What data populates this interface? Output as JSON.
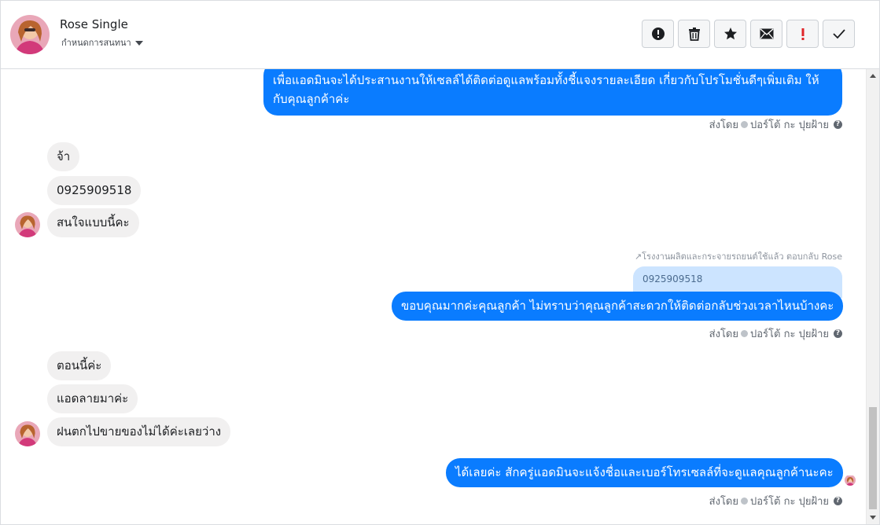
{
  "header": {
    "contact_name": "Rose Single",
    "assign_label": "กำหนดการสนทนา",
    "toolbar": [
      {
        "name": "spam-button",
        "icon": "alert-circle-icon"
      },
      {
        "name": "delete-button",
        "icon": "trash-icon"
      },
      {
        "name": "star-button",
        "icon": "star-icon"
      },
      {
        "name": "mark-unread-button",
        "icon": "envelope-icon"
      },
      {
        "name": "follow-up-button",
        "icon": "exclamation-icon"
      },
      {
        "name": "mark-done-button",
        "icon": "check-icon"
      }
    ]
  },
  "messages": {
    "m1": "เพื่อแอดมินจะได้ประสานงานให้เซลล์ได้ติดต่อดูแลพร้อมทั้งชี้แจงรายละเอียด เกี่ยวกับโปรโมชั่นดีๆเพิ่มเติม ให้กับคุณลูกค้าค่ะ",
    "m1_sent": {
      "prefix": "ส่งโดย",
      "sender": "ปอร์โต้ กะ ปุยฝ้าย"
    },
    "m2": "จ้า",
    "m3": "0925909518",
    "m4": "สนใจแบบนี้คะ",
    "reply_note": "โรงงานผลิตและกระจายรถยนต์ใช้แล้ว ตอบกลับ Rose",
    "quoted_text": "0925909518",
    "m5": "ขอบคุณมากค่ะคุณลูกค้า ไม่ทราบว่าคุณลูกค้าสะดวกให้ติดต่อกลับช่วงเวลาไหนบ้างคะ",
    "m5_sent": {
      "prefix": "ส่งโดย",
      "sender": "ปอร์โต้ กะ ปุยฝ้าย"
    },
    "m6": "ตอนนี้ค่ะ",
    "m7": "แอดลายมาค่ะ",
    "m8": "ฝนตกไปขายของไม่ได้ค่ะเลยว่าง",
    "m9": "ได้เลยค่ะ สักครู่แอดมินจะแจ้งชื่อและเบอร์โทรเซลล์ที่จะดูแลคุณลูกค้านะคะ",
    "m9_sent": {
      "prefix": "ส่งโดย",
      "sender": "ปอร์โต้ กะ ปุยฝ้าย"
    }
  },
  "colors": {
    "outgoing": "#0a7cff",
    "incoming": "#f1f0f0",
    "quoted": "#cce4ff"
  }
}
